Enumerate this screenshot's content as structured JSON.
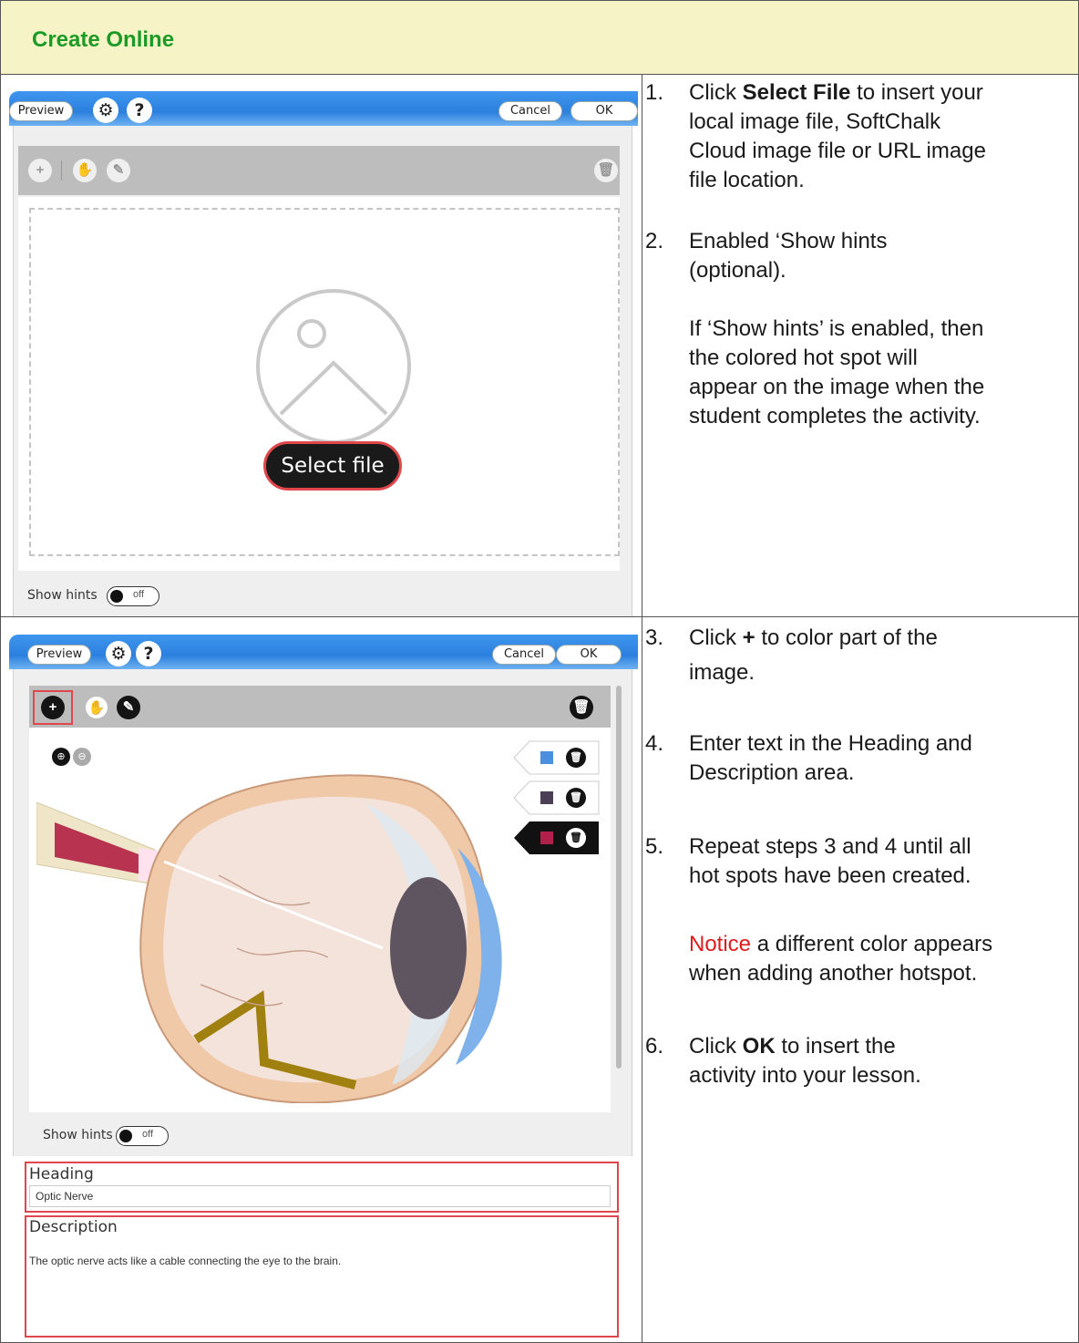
{
  "title": "Create Online",
  "editor_top": {
    "preview": "Preview",
    "cancel": "Cancel",
    "ok": "OK",
    "help": "?",
    "select_file": "Select file",
    "show_hints": "Show hints",
    "toggle_state": "off"
  },
  "editor_bottom": {
    "preview": "Preview",
    "cancel": "Cancel",
    "ok": "OK",
    "help": "?",
    "show_hints": "Show hints",
    "toggle_state": "off",
    "hotspot_colors": [
      "#4a8fe0",
      "#4a3f55",
      "#b0204a"
    ],
    "heading_label": "Heading",
    "heading_value": "Optic Nerve",
    "description_label": "Description",
    "description_value": "The optic nerve acts like a cable connecting the eye to the brain."
  },
  "steps_top": {
    "s1_num": "1.",
    "s1_a": "Click ",
    "s1_bold": "Select File",
    "s1_b": " to insert your",
    "s1_l2": "local image file, SoftChalk",
    "s1_l3": "Cloud image file or URL image",
    "s1_l4": "file location.",
    "s2_num": "2.",
    "s2_l1": "Enabled ‘Show hints",
    "s2_l2": "(optional).",
    "n_l1": "If ‘Show hints’ is enabled, then",
    "n_l2": "the colored hot spot will",
    "n_l3": "appear on the image when the",
    "n_l4": "student completes the activity."
  },
  "steps_bottom": {
    "s3_num": "3.",
    "s3_a": "Click ",
    "s3_bold": "+",
    "s3_b": " to color part of the",
    "s3_l2": "image.",
    "s4_num": "4.",
    "s4_l1": "Enter text in the Heading and",
    "s4_l2": "Description area.",
    "s5_num": "5.",
    "s5_l1": "Repeat steps 3 and 4 until all",
    "s5_l2": "hot spots have been created.",
    "notice_word": "Notice",
    "notice_rest": " a different color appears",
    "notice_l2": "when adding another hotspot.",
    "s6_num": "6.",
    "s6_a": "Click ",
    "s6_bold": "OK",
    "s6_b": " to insert the",
    "s6_l2": "activity into your lesson."
  }
}
